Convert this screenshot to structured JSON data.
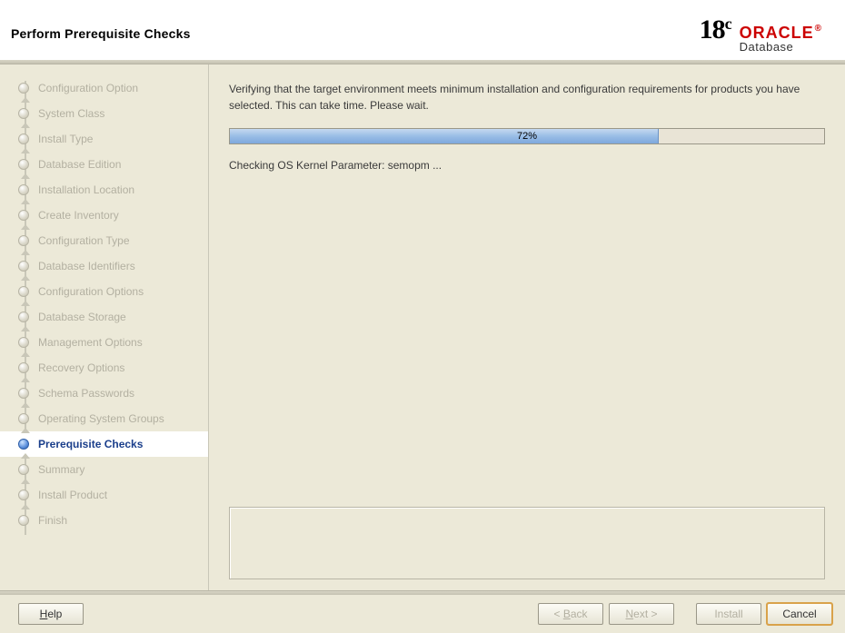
{
  "header": {
    "title": "Perform Prerequisite Checks",
    "logo_version_major": "18",
    "logo_version_suffix": "c",
    "logo_brand": "ORACLE",
    "logo_reg": "®",
    "logo_product": "Database"
  },
  "sidebar": {
    "steps": [
      {
        "label": "Configuration Option",
        "active": false
      },
      {
        "label": "System Class",
        "active": false
      },
      {
        "label": "Install Type",
        "active": false
      },
      {
        "label": "Database Edition",
        "active": false
      },
      {
        "label": "Installation Location",
        "active": false
      },
      {
        "label": "Create Inventory",
        "active": false
      },
      {
        "label": "Configuration Type",
        "active": false
      },
      {
        "label": "Database Identifiers",
        "active": false
      },
      {
        "label": "Configuration Options",
        "active": false
      },
      {
        "label": "Database Storage",
        "active": false
      },
      {
        "label": "Management Options",
        "active": false
      },
      {
        "label": "Recovery Options",
        "active": false
      },
      {
        "label": "Schema Passwords",
        "active": false
      },
      {
        "label": "Operating System Groups",
        "active": false
      },
      {
        "label": "Prerequisite Checks",
        "active": true
      },
      {
        "label": "Summary",
        "active": false
      },
      {
        "label": "Install Product",
        "active": false
      },
      {
        "label": "Finish",
        "active": false
      }
    ]
  },
  "main": {
    "intro": "Verifying that the target environment meets minimum installation and configuration requirements for products you have selected. This can take time. Please wait.",
    "progress_percent": 72,
    "progress_label": "72%",
    "status": "Checking OS Kernel Parameter: semopm ..."
  },
  "footer": {
    "help_label": "Help",
    "back_label": "< Back",
    "next_label": "Next >",
    "install_label": "Install",
    "cancel_label": "Cancel"
  }
}
